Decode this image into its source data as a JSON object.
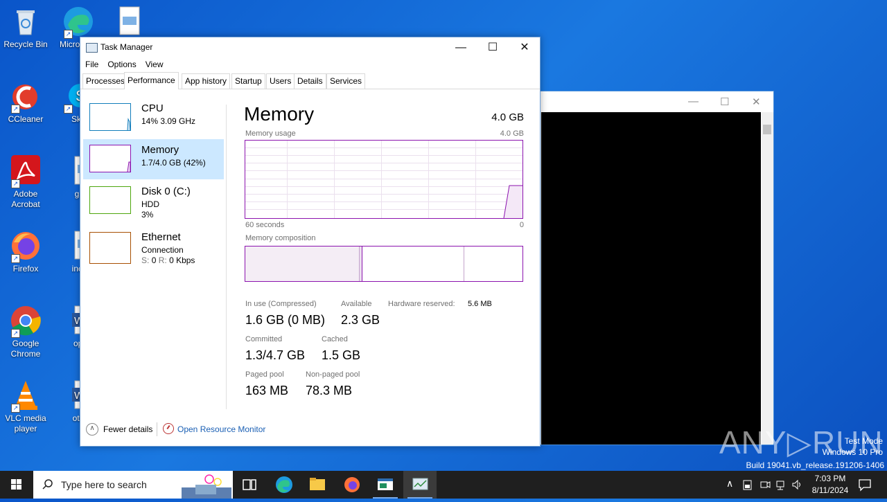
{
  "desktop": {
    "icons": [
      {
        "label": "Recycle Bin"
      },
      {
        "label": "Micro Edg"
      },
      {
        "label": "CCleaner"
      },
      {
        "label": "Sky"
      },
      {
        "label": "Adobe Acrobat"
      },
      {
        "label": "gradu"
      },
      {
        "label": "Firefox"
      },
      {
        "label": "incbar"
      },
      {
        "label": "Google Chrome"
      },
      {
        "label": "operat"
      },
      {
        "label": "VLC media player"
      },
      {
        "label": "otheral"
      }
    ]
  },
  "task_manager": {
    "title": "Task Manager",
    "controls": {
      "minimize": "—",
      "maximize": "☐",
      "close": "✕"
    },
    "menu": [
      "File",
      "Options",
      "View"
    ],
    "tabs": [
      "Processes",
      "Performance",
      "App history",
      "Startup",
      "Users",
      "Details",
      "Services"
    ],
    "active_tab": "Performance",
    "sidebar": [
      {
        "title": "CPU",
        "line1": "14% 3.09 GHz",
        "line2": "",
        "color": "#117dbb"
      },
      {
        "title": "Memory",
        "line1": "1.7/4.0 GB (42%)",
        "line2": "",
        "color": "#8b12ae"
      },
      {
        "title": "Disk 0 (C:)",
        "line1": "HDD",
        "line2": "3%",
        "color": "#4da60c"
      },
      {
        "title": "Ethernet",
        "line1": "Connection",
        "line2_s": "S:",
        "line2_sv": "0",
        "line2_r": "R:",
        "line2_rv": "0 Kbps",
        "color": "#a74f01"
      }
    ],
    "panel": {
      "title": "Memory",
      "capacity": "4.0 GB",
      "usage_label": "Memory usage",
      "usage_max": "4.0 GB",
      "time_left": "60 seconds",
      "time_right": "0",
      "composition_label": "Memory composition",
      "stats": {
        "in_use_label": "In use (Compressed)",
        "in_use_value": "1.6 GB (0 MB)",
        "available_label": "Available",
        "available_value": "2.3 GB",
        "hw_reserved_label": "Hardware reserved:",
        "hw_reserved_value": "5.6 MB",
        "committed_label": "Committed",
        "committed_value": "1.3/4.7 GB",
        "cached_label": "Cached",
        "cached_value": "1.5 GB",
        "paged_label": "Paged pool",
        "paged_value": "163 MB",
        "nonpaged_label": "Non-paged pool",
        "nonpaged_value": "78.3 MB"
      }
    },
    "footer": {
      "fewer_details": "Fewer details",
      "open_monitor": "Open Resource Monitor"
    }
  },
  "bg_window": {
    "controls": {
      "minimize": "—",
      "maximize": "☐",
      "close": "✕"
    }
  },
  "taskbar": {
    "search_placeholder": "Type here to search",
    "time": "7:03 PM",
    "date": "8/11/2024"
  },
  "watermark": {
    "brand": "ANY▷RUN",
    "line1": "Test Mode",
    "line2": "Windows 10 Pro",
    "line3": "Build 19041.vb_release.191206-1406"
  },
  "colors": {
    "memory_accent": "#8b12ae",
    "selection": "#cce8ff",
    "link": "#1a5fb4"
  }
}
